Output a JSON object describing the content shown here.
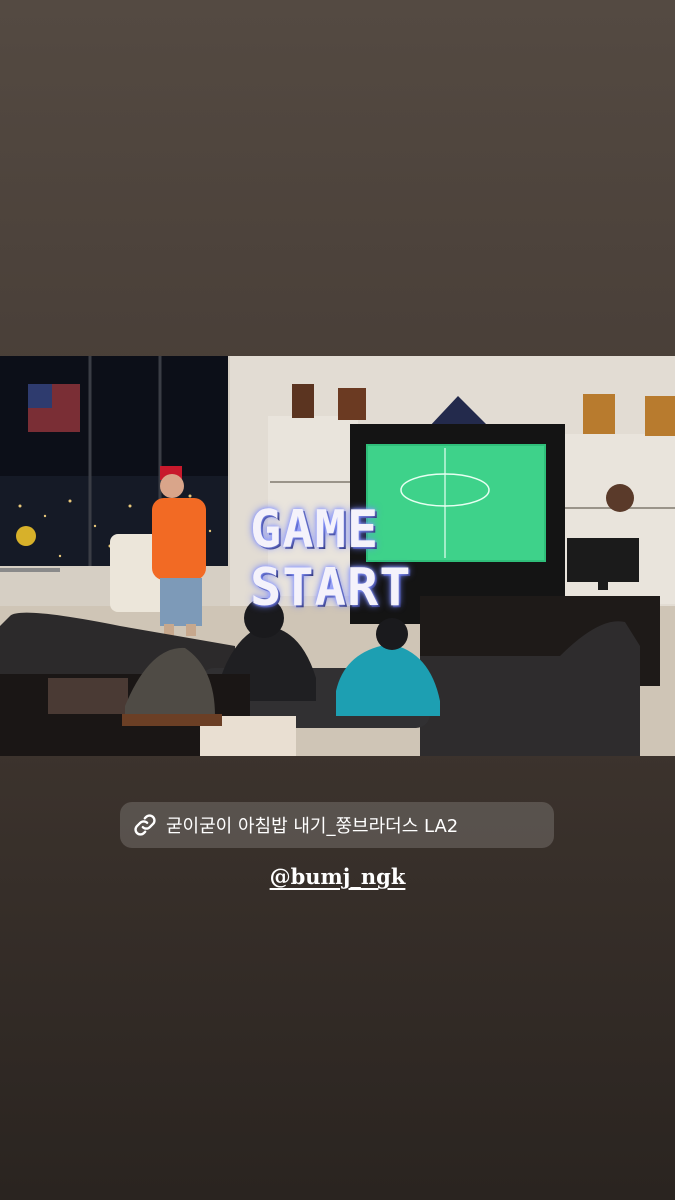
{
  "story": {
    "overlay_text": {
      "line1": "GAME",
      "line2": "START"
    },
    "link_sticker": {
      "icon": "link-icon",
      "label": "굳이굳이 아침밥 내기_쭝브라더스 LA2"
    },
    "mention": "@bumj_ngk"
  },
  "colors": {
    "background_top": "#544a42",
    "background_bottom": "#2a2420",
    "sticker_bg": "rgba(255,255,255,0.16)",
    "text": "#ffffff"
  }
}
